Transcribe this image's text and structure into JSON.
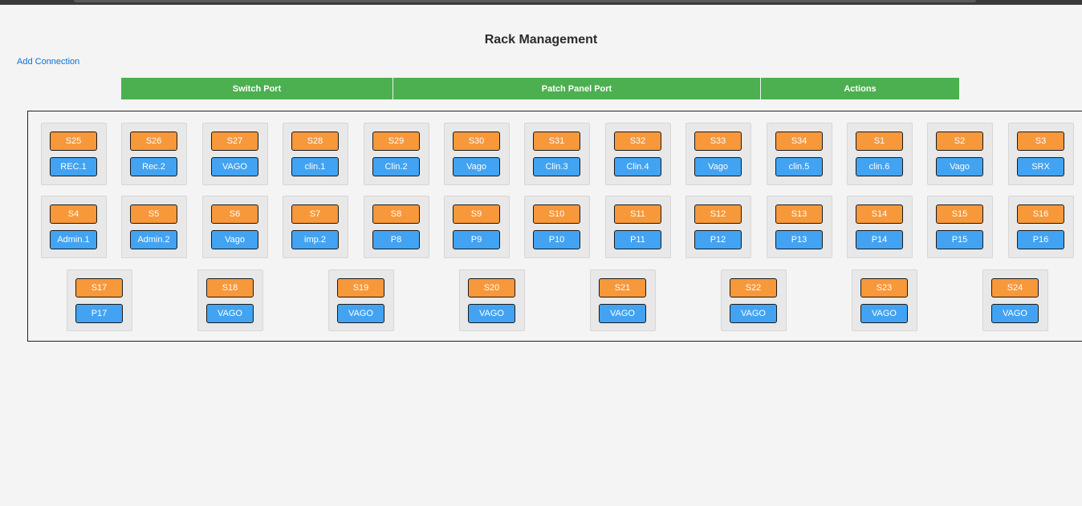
{
  "page": {
    "title": "Rack Management"
  },
  "toolbar": {
    "add_connection_label": "Add Connection"
  },
  "header": {
    "switch_port": "Switch Port",
    "patch_panel_port": "Patch Panel Port",
    "actions": "Actions"
  },
  "colors": {
    "switch_port": "#f7983b",
    "patch_panel_port": "#42a3f2",
    "header": "#4caf50",
    "link": "#0b6fd8"
  },
  "rows": [
    [
      {
        "switch": "S25",
        "patch": "REC.1"
      },
      {
        "switch": "S26",
        "patch": "Rec.2"
      },
      {
        "switch": "S27",
        "patch": "VAGO"
      },
      {
        "switch": "S28",
        "patch": "clin.1"
      },
      {
        "switch": "S29",
        "patch": "Clin.2"
      },
      {
        "switch": "S30",
        "patch": "Vago"
      },
      {
        "switch": "S31",
        "patch": "Clin.3"
      },
      {
        "switch": "S32",
        "patch": "Clin.4"
      },
      {
        "switch": "S33",
        "patch": "Vago"
      },
      {
        "switch": "S34",
        "patch": "clin.5"
      },
      {
        "switch": "S1",
        "patch": "clin.6"
      },
      {
        "switch": "S2",
        "patch": "Vago"
      },
      {
        "switch": "S3",
        "patch": "SRX"
      }
    ],
    [
      {
        "switch": "S4",
        "patch": "Admin.1"
      },
      {
        "switch": "S5",
        "patch": "Admin.2"
      },
      {
        "switch": "S6",
        "patch": "Vago"
      },
      {
        "switch": "S7",
        "patch": "imp.2"
      },
      {
        "switch": "S8",
        "patch": "P8"
      },
      {
        "switch": "S9",
        "patch": "P9"
      },
      {
        "switch": "S10",
        "patch": "P10"
      },
      {
        "switch": "S11",
        "patch": "P11"
      },
      {
        "switch": "S12",
        "patch": "P12"
      },
      {
        "switch": "S13",
        "patch": "P13"
      },
      {
        "switch": "S14",
        "patch": "P14"
      },
      {
        "switch": "S15",
        "patch": "P15"
      },
      {
        "switch": "S16",
        "patch": "P16"
      }
    ],
    [
      {
        "switch": "S17",
        "patch": "P17"
      },
      {
        "switch": "S18",
        "patch": "VAGO"
      },
      {
        "switch": "S19",
        "patch": "VAGO"
      },
      {
        "switch": "S20",
        "patch": "VAGO"
      },
      {
        "switch": "S21",
        "patch": "VAGO"
      },
      {
        "switch": "S22",
        "patch": "VAGO"
      },
      {
        "switch": "S23",
        "patch": "VAGO"
      },
      {
        "switch": "S24",
        "patch": "VAGO"
      }
    ]
  ]
}
